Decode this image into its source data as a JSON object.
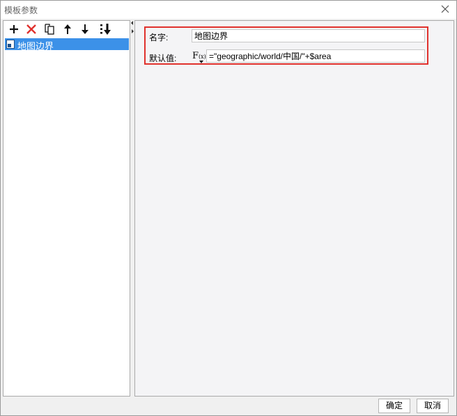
{
  "window": {
    "title": "模板参数"
  },
  "toolbar": {
    "buttons": [
      {
        "icon": "add-icon"
      },
      {
        "icon": "delete-icon"
      },
      {
        "icon": "copy-icon"
      },
      {
        "icon": "move-up-icon"
      },
      {
        "icon": "move-down-icon"
      },
      {
        "icon": "sort-icon"
      }
    ]
  },
  "tree": {
    "items": [
      {
        "label": "地图边界",
        "selected": true
      }
    ]
  },
  "form": {
    "name_label": "名字:",
    "name_value": "地图边界",
    "default_label": "默认值:",
    "fx_label": "F",
    "fx_sub": "(x)",
    "default_value": "=\"geographic/world/中国/\"+$area"
  },
  "footer": {
    "ok_label": "确定",
    "cancel_label": "取消"
  },
  "colors": {
    "selection": "#3c91e8",
    "highlight_border": "#e0312d",
    "delete": "#e0312d"
  }
}
